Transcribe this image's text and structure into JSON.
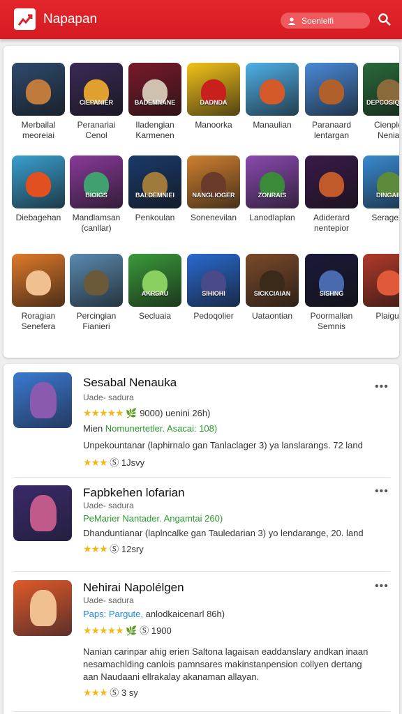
{
  "header": {
    "app_title": "Napapan",
    "search_placeholder": "Soenlelfi",
    "logo_icon": "trend-chart-icon",
    "search_icon": "search-icon",
    "user_icon": "user-icon",
    "color": "#d9232a"
  },
  "grid": [
    {
      "label": "Merbailal\nmeoreiai",
      "cap": "",
      "bg": "#2f4a6e",
      "fig": "#c07a3c"
    },
    {
      "label": "Peranariai\nCenol",
      "cap": "CIEPANIER",
      "bg": "#3a2a56",
      "fig": "#e0a030"
    },
    {
      "label": "Iladengian\nKarmenen",
      "cap": "BADEMNANE",
      "bg": "#7a1a2a",
      "fig": "#d0c0b0"
    },
    {
      "label": "Manoorka",
      "cap": "DADNDA",
      "bg": "#f3c21a",
      "fig": "#c8201c"
    },
    {
      "label": "Manaulian",
      "cap": "",
      "bg": "#4fb0e8",
      "fig": "#d45a2a"
    },
    {
      "label": "Paranaard\nlentargan",
      "cap": "",
      "bg": "#4a8ad8",
      "fig": "#b0602a"
    },
    {
      "label": "Cienplet\nNenial",
      "cap": "DEPCOSIQUEP",
      "bg": "#2a6a3a",
      "fig": "#8a6a3a"
    },
    {
      "label": "Diebagehan",
      "cap": "",
      "bg": "#3aa0d0",
      "fig": "#e05020"
    },
    {
      "label": "Mandlamsan\n(canllar)",
      "cap": "BIOIGS",
      "bg": "#8a3a9a",
      "fig": "#40a070"
    },
    {
      "label": "Penkoulan",
      "cap": "BALDEMNIEI",
      "bg": "#1a3a6a",
      "fig": "#a07a3a"
    },
    {
      "label": "Sonenevilan",
      "cap": "NANGLIOGER",
      "bg": "#d08030",
      "fig": "#6a3a2a"
    },
    {
      "label": "Lanodlaplan",
      "cap": "ZONRAIS",
      "bg": "#8a4ab0",
      "fig": "#3a8a3a"
    },
    {
      "label": "Adiderard\nnentepior",
      "cap": "",
      "bg": "#3a1a4a",
      "fig": "#c05a2a"
    },
    {
      "label": "Seragexa",
      "cap": "DINGAID",
      "bg": "#3a8ad0",
      "fig": "#5a8a3a"
    },
    {
      "label": "Roragian\nSenefera",
      "cap": "",
      "bg": "#e07a2a",
      "fig": "#f0c090"
    },
    {
      "label": "Percingian\nFianieri",
      "cap": "",
      "bg": "#5a8ab0",
      "fig": "#6a5a3a"
    },
    {
      "label": "Secluaia",
      "cap": "AKRSAU",
      "bg": "#3a9a3a",
      "fig": "#8ad060"
    },
    {
      "label": "Pedoqolier",
      "cap": "SIHIOHI",
      "bg": "#2a6ad0",
      "fig": "#4a4a8a"
    },
    {
      "label": "Uataontian",
      "cap": "SICKCIAIAN",
      "bg": "#7a4a2a",
      "fig": "#3a2a1a"
    },
    {
      "label": "Poormallan\nSemnis",
      "cap": "SISHNG",
      "bg": "#1a1a3a",
      "fig": "#4a6ab0"
    },
    {
      "label": "Plaigus",
      "cap": "",
      "bg": "#b03a2a",
      "fig": "#e05a3a"
    }
  ],
  "list": [
    {
      "title": "Sesabal Nenauka",
      "sub": "Uade- sadura",
      "rating_stars": "★★★★★",
      "meta": "9000) uenini 26h)",
      "green_prefix": "Mien ",
      "green_text": "Nomunertetler. Asacai: 108)",
      "body": "Unpekountanar (laphirnalo gan Tanlaclager 3) ya lanslarangs. 72 land",
      "short_stars": "★★★",
      "short_meta": "1Jsvy",
      "thumb_bg": "#3a7ad0",
      "thumb_fig": "#8a5ab0",
      "more": "•••"
    },
    {
      "title": "Fapbkehen lofarian",
      "sub": "Uade- sadura",
      "green_text": "PeMarier Nantader. Angamtai 260)",
      "body": "Dhanduntianar (laplncalke gan Tauledarian 3) yo lendarange, 20. land",
      "short_stars": "★★★",
      "short_meta": "12sry",
      "thumb_bg": "#3a2a6a",
      "thumb_fig": "#c05a8a",
      "more": "•••"
    },
    {
      "title": "Nehirai Napolélgen",
      "sub": "Uade- sadura",
      "blue_text": "Paps: Pargute,",
      "blue_rest": "anlodkaicenarl 86h)",
      "rating_stars": "★★★★★",
      "meta": "1900",
      "body": "Nanian carinpar ahig erien Saltona lagaisan eaddanslary andkan inaan nesamachlding canlois pamnsares makinstanpension collyen dertang aan Naudaani ellrakalay akanaman allayan.",
      "short_stars": "★★★",
      "short_meta": "3 sy",
      "thumb_bg": "#e05a2a",
      "thumb_fig": "#f0c090",
      "more": "•••"
    }
  ]
}
